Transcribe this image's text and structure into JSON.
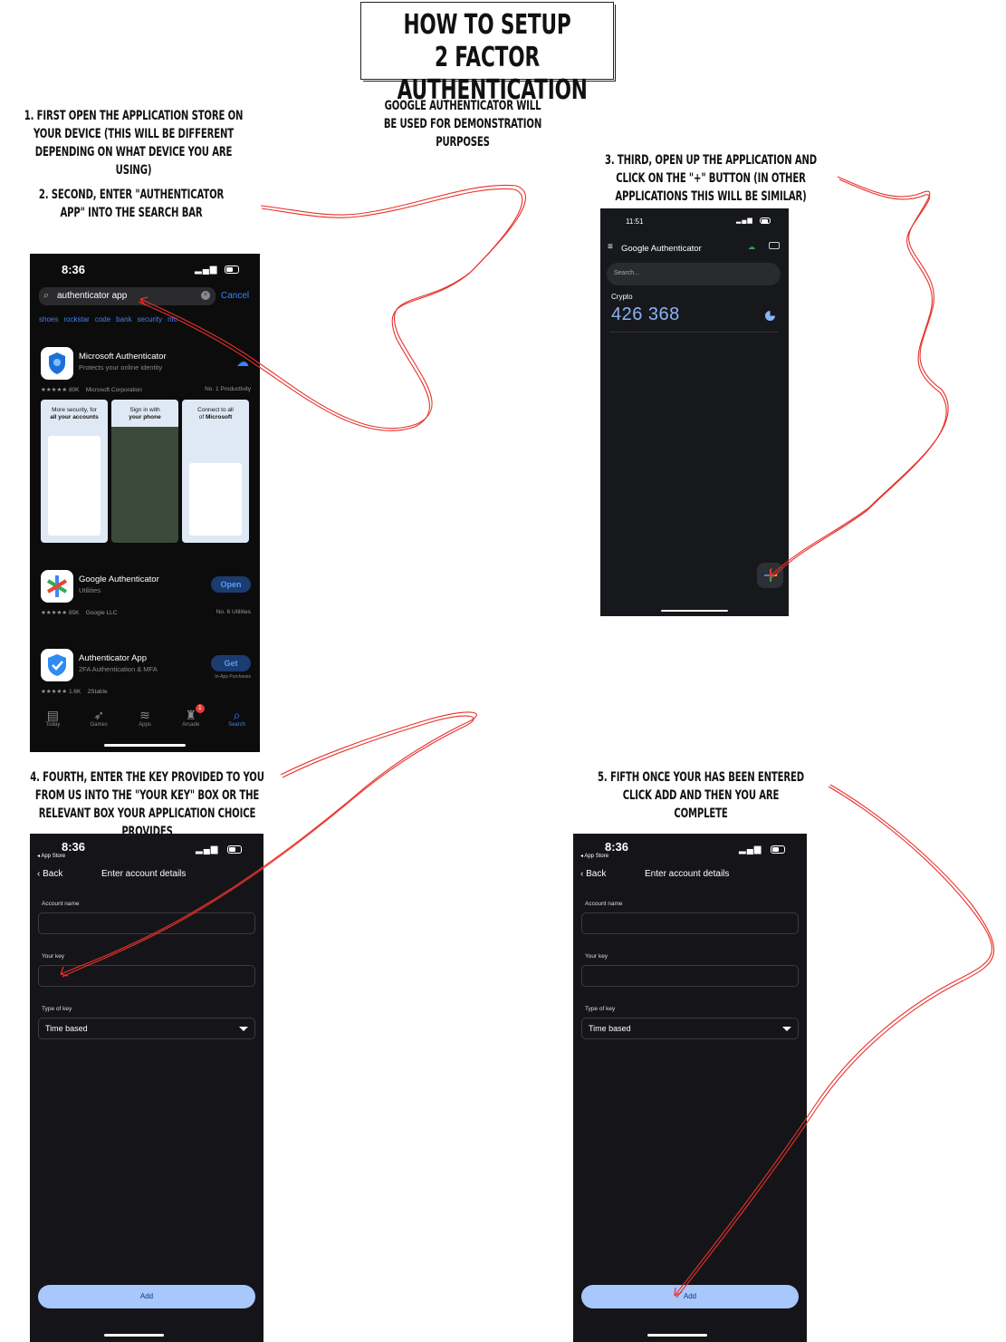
{
  "title": "How to setup 2 factor authentication",
  "subtitle": "Google authenticator will be used for demonstration purposes",
  "steps": {
    "s1": "1. First open the application store on your device (this will be different depending on what device you are using)",
    "s2": "2. Second, enter \"authenticator app\" into the search bar",
    "s3": "3. Third, open up the application and click on the \"+\" button (in other applications this will be similar)",
    "s4": "4. Fourth, enter the key provided to you from us into the \"your key\" box or the relevant box your application choice provides",
    "s5": "5. Fifth once your has been entered click add and then you are complete"
  },
  "appstore": {
    "time": "8:36",
    "search_value": "authenticator app",
    "cancel": "Cancel",
    "chips": [
      "shoes",
      "rockstar",
      "code",
      "bank",
      "security",
      "nfc"
    ],
    "results": [
      {
        "name": "Microsoft Authenticator",
        "sub": "Protects your online identity",
        "rating": "★★★★★ 80K",
        "dev": "Microsoft Corporation",
        "cat": "No. 1 Productivity",
        "action": ""
      },
      {
        "name": "Google Authenticator",
        "sub": "Utilities",
        "rating": "★★★★★ 85K",
        "dev": "Google LLC",
        "cat": "No. 6 Utilities",
        "action": "Open"
      },
      {
        "name": "Authenticator App",
        "sub": "2FA Authentication & MFA",
        "rating": "★★★★★ 1.6K",
        "dev": "2Stable",
        "cat": "",
        "action": "Get",
        "note": "In-App Purchases"
      }
    ],
    "screenshots": [
      {
        "line1": "More security, for",
        "line2": "all your accounts"
      },
      {
        "line1": "Sign in with",
        "line2": "your phone"
      },
      {
        "line1": "Connect to all",
        "line2": "of Microsoft"
      }
    ],
    "tabs": [
      "Today",
      "Games",
      "Apps",
      "Arcade",
      "Search"
    ],
    "arcade_badge": "1"
  },
  "ga": {
    "time": "11:51",
    "title": "Google Authenticator",
    "search_placeholder": "Search...",
    "issuer": "Crypto",
    "code": "426 368"
  },
  "entry": {
    "time": "8:36",
    "app_store_back": "◂ App Store",
    "back": "Back",
    "header": "Enter account details",
    "account_name_label": "Account name",
    "your_key_label": "Your key",
    "type_label": "Type of key",
    "type_value": "Time based",
    "add": "Add"
  },
  "colors": {
    "arrow": "#e8312b",
    "accent": "#3b82f6",
    "ga_code": "#8ab4f8",
    "add_button": "#a8c7fa"
  }
}
